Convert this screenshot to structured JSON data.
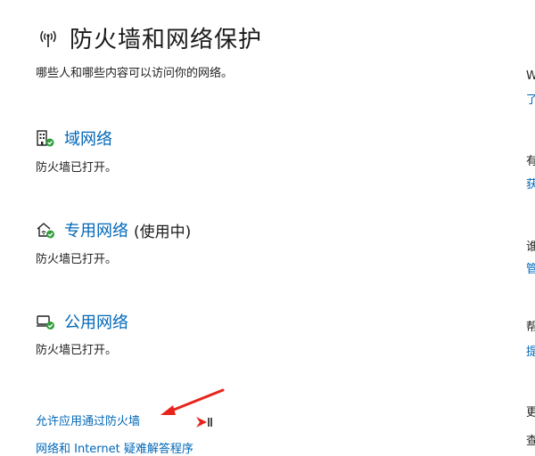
{
  "header": {
    "title": "防火墙和网络保护",
    "subtitle": "哪些人和哪些内容可以访问你的网络。",
    "icon": "wifi-broadcast-icon"
  },
  "networks": [
    {
      "name": "域网络",
      "extra": "",
      "status": "防火墙已打开。",
      "icon": "building-icon"
    },
    {
      "name": "专用网络",
      "extra": "(使用中)",
      "status": "防火墙已打开。",
      "icon": "home-network-icon"
    },
    {
      "name": "公用网络",
      "extra": "",
      "status": "防火墙已打开。",
      "icon": "public-network-icon"
    }
  ],
  "links": {
    "allow_app": "允许应用通过防火墙",
    "troubleshooter": "网络和 Internet 疑难解答程序"
  },
  "right_column": {
    "chars": [
      "W",
      "了",
      "有",
      "获",
      "谁",
      "管",
      "帮",
      "提",
      "更",
      "查"
    ]
  },
  "colors": {
    "link": "#0067b8",
    "status_ok": "#2e9e3a",
    "arrow": "#e8231b"
  }
}
